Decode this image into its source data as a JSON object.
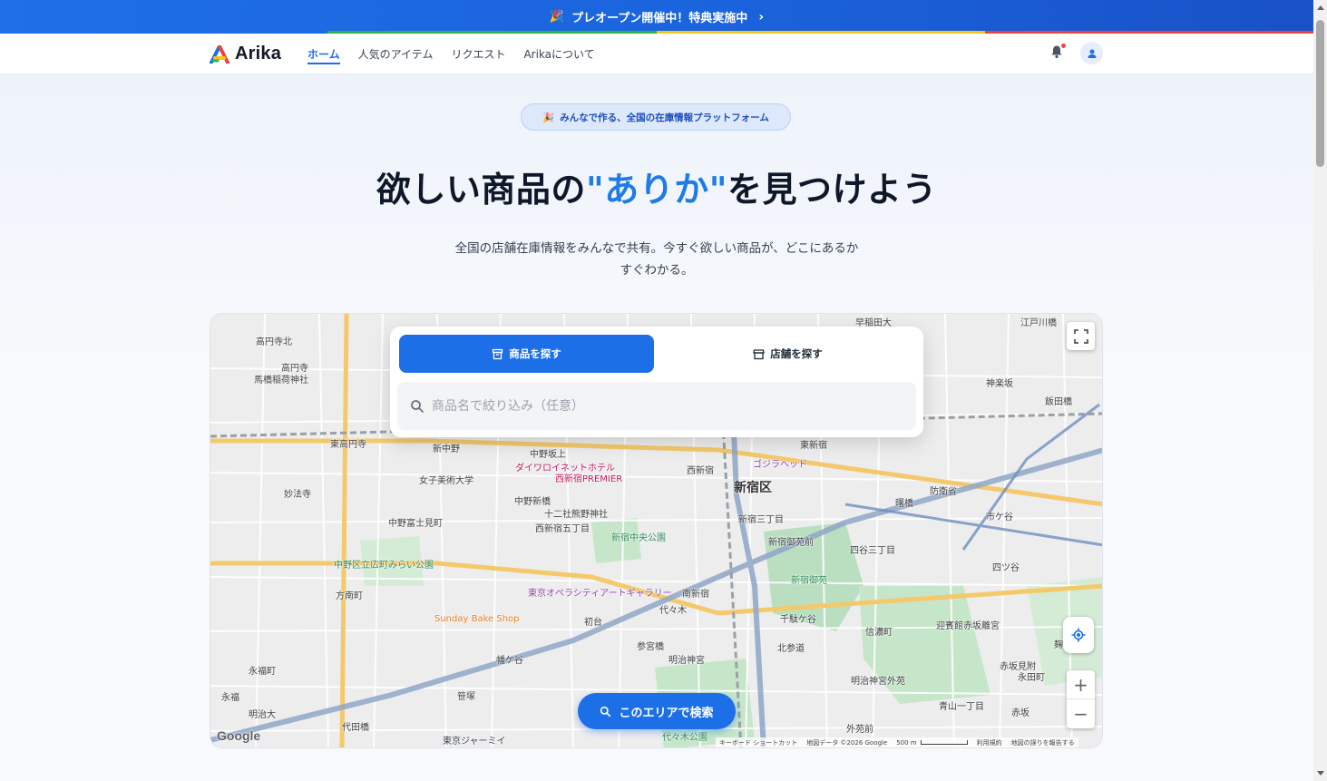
{
  "announcement": {
    "icon": "party-popper-icon",
    "text": "プレオープン開催中！特典実施中",
    "chevron": "›"
  },
  "brand": {
    "name": "Arika"
  },
  "nav": {
    "items": [
      {
        "label": "ホーム",
        "active": true
      },
      {
        "label": "人気のアイテム",
        "active": false
      },
      {
        "label": "リクエスト",
        "active": false
      },
      {
        "label": "Arikaについて",
        "active": false
      }
    ]
  },
  "hero": {
    "pill": "みんなで作る、全国の在庫情報プラットフォーム",
    "title_before": "欲しい商品の",
    "title_highlight": "\"ありか\"",
    "title_after": "を見つけよう",
    "subtitle_line1": "全国の店舗在庫情報をみんなで共有。今すぐ欲しい商品が、どこにあるか",
    "subtitle_line2": "すぐわかる。"
  },
  "search": {
    "tab_products": "商品を探す",
    "tab_stores": "店舗を探す",
    "active_tab": "products",
    "placeholder": "商品名で絞り込み（任意）",
    "value": ""
  },
  "map": {
    "area_search_button": "このエリアで検索",
    "google_logo": "Google",
    "attribution": {
      "shortcuts": "キーボード ショートカット",
      "data": "地図データ ©2026 Google",
      "scale": "500 m",
      "terms": "利用規約",
      "report": "地図の誤りを報告する"
    },
    "labels": [
      "早稲田大",
      "江戸川橋",
      "神楽坂",
      "飯田橋",
      "高円寺北",
      "高円寺",
      "馬橋稲荷神社",
      "東高円寺",
      "新中野",
      "中野坂上",
      "西新宿",
      "東新宿",
      "女子美術大学",
      "ダイワロイネットホテル",
      "西新宿PREMIER",
      "ゴジラヘッド",
      "新宿区",
      "妙法寺",
      "中野新橋",
      "十二社熊野神社",
      "西新宿五丁目",
      "新宿中央公園",
      "新宿三丁目",
      "新宿御苑前",
      "四谷三丁目",
      "四ツ谷",
      "防衛省",
      "曙橋",
      "市ケ谷",
      "中野富士見町",
      "中野区立広町みらい公園",
      "方南町",
      "東京オペラシティアートギャラリー",
      "南新宿",
      "新宿御苑",
      "Sunday Bake Shop",
      "初台",
      "代々木",
      "参宮橋",
      "明治神宮",
      "千駄ケ谷",
      "北参道",
      "信濃町",
      "迎賓館赤坂離宮",
      "幡ケ谷",
      "笹塚",
      "永福町",
      "永福",
      "明治大",
      "代田橋",
      "東京ジャーミイ",
      "代々木公園",
      "明治神宮外苑",
      "青山一丁目",
      "外苑前",
      "赤坂見附",
      "赤坂",
      "永田町",
      "麹町"
    ]
  },
  "colors": {
    "primary": "#1d6fe8",
    "highlight": "#1e7be8",
    "badge_bg": "#dde9fb"
  }
}
